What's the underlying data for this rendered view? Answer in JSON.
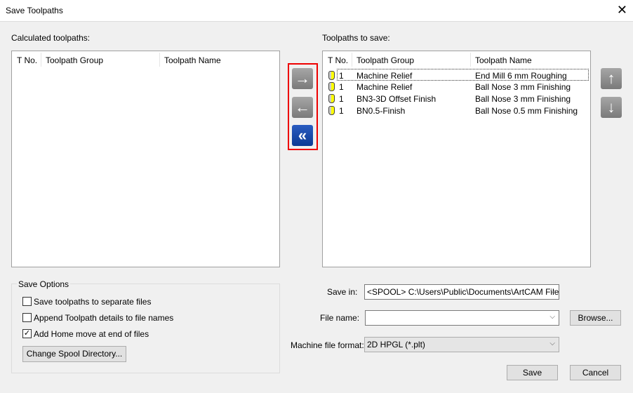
{
  "window": {
    "title": "Save Toolpaths",
    "close": "✕"
  },
  "left": {
    "label": "Calculated toolpaths:",
    "columns": [
      "T No.",
      "Toolpath Group",
      "Toolpath Name"
    ]
  },
  "right": {
    "label": "Toolpaths to save:",
    "columns": [
      "T No.",
      "Toolpath Group",
      "Toolpath Name"
    ],
    "rows": [
      {
        "tno": "1",
        "group": "Machine Relief",
        "name": "End Mill 6 mm Roughing"
      },
      {
        "tno": "1",
        "group": "Machine Relief",
        "name": "Ball Nose 3 mm Finishing"
      },
      {
        "tno": "1",
        "group": "BN3-3D Offset Finish",
        "name": "Ball Nose 3 mm Finishing"
      },
      {
        "tno": "1",
        "group": "BN0.5-Finish",
        "name": "Ball Nose 0.5 mm Finishing"
      }
    ]
  },
  "icons": {
    "add": "→",
    "remove": "←",
    "remove_all": "«",
    "up": "↑",
    "down": "↓"
  },
  "options": {
    "title": "Save Options",
    "separate": {
      "label": "Save toolpaths to separate files",
      "checked": false
    },
    "append": {
      "label": "Append Toolpath details to file names",
      "checked": false
    },
    "home": {
      "label": "Add Home move at end of files",
      "checked": true,
      "mark": "✓"
    },
    "spool_button": "Change Spool Directory..."
  },
  "form": {
    "save_in_label": "Save in:",
    "save_in": "<SPOOL> C:\\Users\\Public\\Documents\\ArtCAM Files\\",
    "file_name_label": "File name:",
    "file_name": "",
    "browse": "Browse...",
    "format_label": "Machine file format:",
    "format": "2D HPGL (*.plt)",
    "arrow": "⌵"
  },
  "buttons": {
    "save": "Save",
    "cancel": "Cancel"
  }
}
